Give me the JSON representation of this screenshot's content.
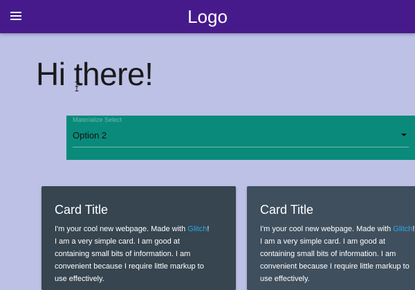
{
  "navbar": {
    "logo": "Logo",
    "menu_icon": "hamburger-menu-icon",
    "color": "#471a8c"
  },
  "main": {
    "heading": "Hi there!",
    "background_color": "#bdc1e6"
  },
  "select": {
    "label": "Materialize Select",
    "value": "Option 2",
    "caret_icon": "caret-down-icon",
    "background_color": "#0a8a7a"
  },
  "cards": [
    {
      "title": "Card Title",
      "text_before_link": "I'm your cool new webpage. Made with ",
      "link_text": "Glitch",
      "text_after_link": "!",
      "line2": "I am a very simple card. I am good at",
      "line3": "containing small bits of information. I am",
      "line4": "convenient because I require little markup to",
      "line5": "use effectively.",
      "background_color": "#36454f"
    },
    {
      "title": "Card Title",
      "text_before_link": "I'm your cool new webpage. Made with ",
      "link_text": "Glitch",
      "text_after_link": "!",
      "line2": "I am a very simple card. I am good at",
      "line3": "containing small bits of information. I am",
      "line4": "convenient because I require little markup to",
      "line5": "use effectively.",
      "background_color": "#3f4f5e"
    }
  ]
}
